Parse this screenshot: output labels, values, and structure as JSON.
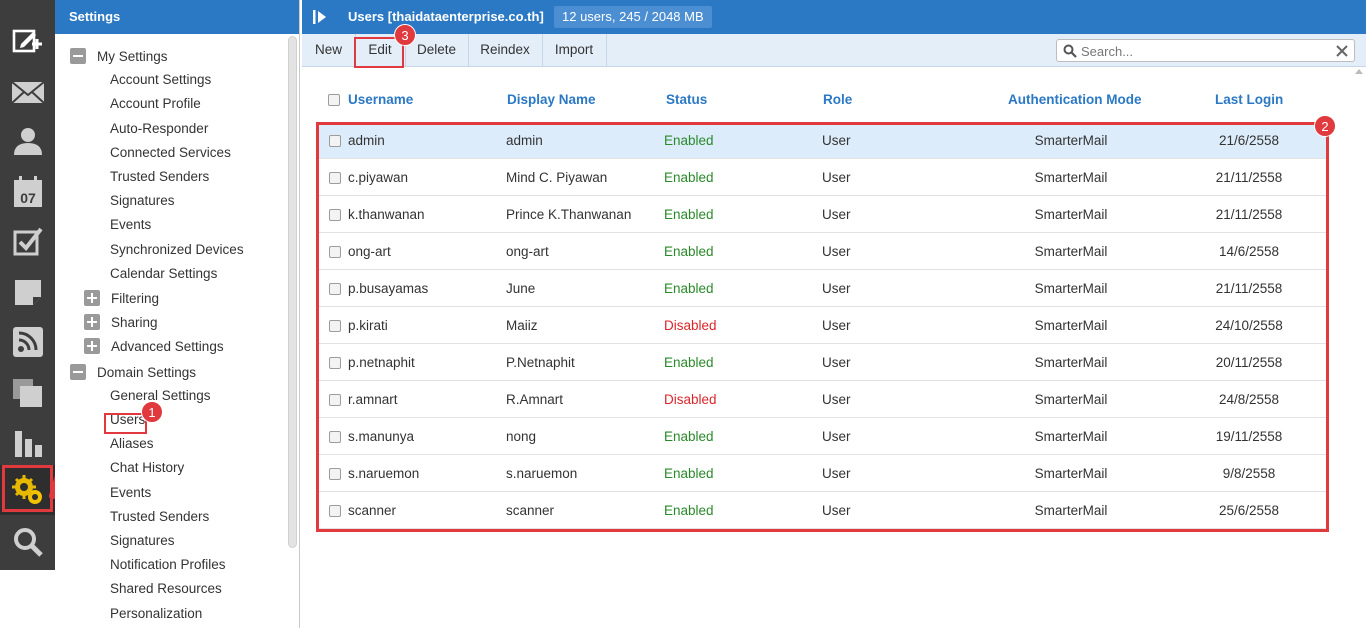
{
  "colors": {
    "header_blue": "#2b78c5",
    "toolbar_bg": "#e4eef8",
    "enabled": "#2a8a2a",
    "disabled": "#d9262b",
    "annotation_red": "#e0393e",
    "rail_bg": "#3d3d3d"
  },
  "rail": {
    "icons": [
      "compose-icon",
      "mail-icon",
      "contacts-icon",
      "calendar-icon",
      "tasks-icon",
      "notes-icon",
      "rss-icon",
      "files-icon",
      "reports-icon",
      "settings-icon",
      "search-icon"
    ],
    "calendar_day": "07"
  },
  "tree": {
    "title": "Settings",
    "my_settings": {
      "label": "My Settings",
      "items": [
        "Account Settings",
        "Account Profile",
        "Auto-Responder",
        "Connected Services",
        "Trusted Senders",
        "Signatures",
        "Events",
        "Synchronized Devices",
        "Calendar Settings"
      ]
    },
    "collapsed_groups": [
      "Filtering",
      "Sharing",
      "Advanced Settings"
    ],
    "domain_settings": {
      "label": "Domain Settings",
      "items": [
        "General Settings",
        "Users",
        "Aliases",
        "Chat History",
        "Events",
        "Trusted Senders",
        "Signatures",
        "Notification Profiles",
        "Shared Resources",
        "Personalization"
      ]
    }
  },
  "header": {
    "title": "Users [thaidataenterprise.co.th]",
    "count": "12 users, 245 / 2048 MB"
  },
  "toolbar": {
    "new": "New",
    "edit": "Edit",
    "delete": "Delete",
    "reindex": "Reindex",
    "import": "Import",
    "search_placeholder": "Search..."
  },
  "grid": {
    "columns": [
      "Username",
      "Display Name",
      "Status",
      "Role",
      "Authentication Mode",
      "Last Login"
    ],
    "rows": [
      {
        "username": "admin",
        "display": "admin",
        "status": "Enabled",
        "role": "User",
        "auth": "SmarterMail",
        "last": "21/6/2558"
      },
      {
        "username": "c.piyawan",
        "display": "Mind C. Piyawan",
        "status": "Enabled",
        "role": "User",
        "auth": "SmarterMail",
        "last": "21/11/2558"
      },
      {
        "username": "k.thanwanan",
        "display": "Prince K.Thanwanan",
        "status": "Enabled",
        "role": "User",
        "auth": "SmarterMail",
        "last": "21/11/2558"
      },
      {
        "username": "ong-art",
        "display": "ong-art",
        "status": "Enabled",
        "role": "User",
        "auth": "SmarterMail",
        "last": "14/6/2558"
      },
      {
        "username": "p.busayamas",
        "display": "June",
        "status": "Enabled",
        "role": "User",
        "auth": "SmarterMail",
        "last": "21/11/2558"
      },
      {
        "username": "p.kirati",
        "display": "Maiiz",
        "status": "Disabled",
        "role": "User",
        "auth": "SmarterMail",
        "last": "24/10/2558"
      },
      {
        "username": "p.netnaphit",
        "display": "P.Netnaphit",
        "status": "Enabled",
        "role": "User",
        "auth": "SmarterMail",
        "last": "20/11/2558"
      },
      {
        "username": "r.amnart",
        "display": "R.Amnart",
        "status": "Disabled",
        "role": "User",
        "auth": "SmarterMail",
        "last": "24/8/2558"
      },
      {
        "username": "s.manunya",
        "display": "nong",
        "status": "Enabled",
        "role": "User",
        "auth": "SmarterMail",
        "last": "19/11/2558"
      },
      {
        "username": "s.naruemon",
        "display": "s.naruemon",
        "status": "Enabled",
        "role": "User",
        "auth": "SmarterMail",
        "last": "9/8/2558"
      },
      {
        "username": "scanner",
        "display": "scanner",
        "status": "Enabled",
        "role": "User",
        "auth": "SmarterMail",
        "last": "25/6/2558"
      }
    ]
  },
  "annotations": {
    "step1": "1",
    "step2": "2",
    "step3": "3"
  }
}
